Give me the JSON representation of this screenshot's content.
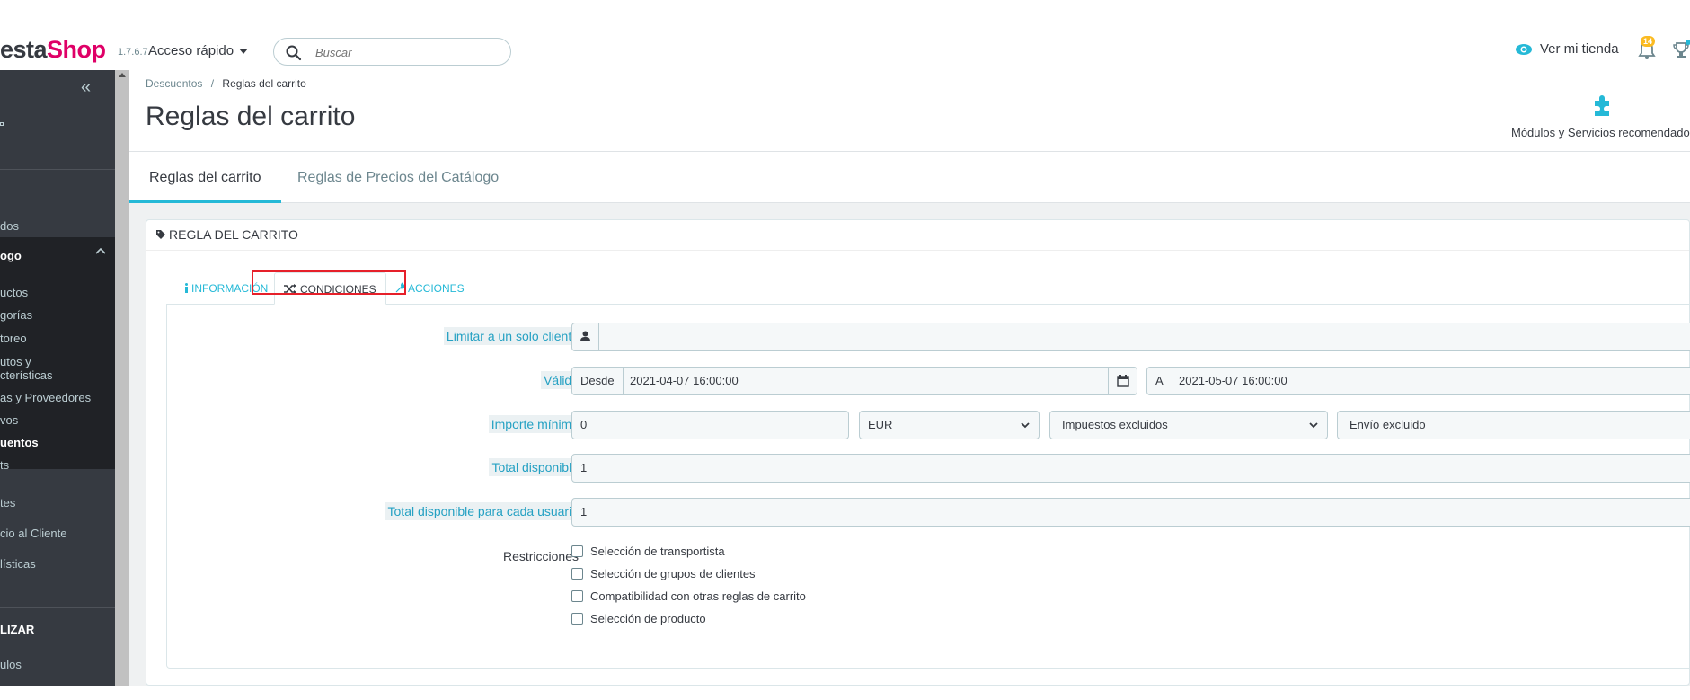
{
  "header": {
    "logo_part1": "",
    "logo_part2": "esta",
    "logo_part3": "Shop",
    "version": "1.7.6.7",
    "quick_access": "Acceso rápido",
    "search_placeholder": "Buscar",
    "view_shop": "Ver mi tienda",
    "notifications_count": "14"
  },
  "sidebar": {
    "items": [
      {
        "label": "dos"
      },
      {
        "label": "ogo"
      },
      {
        "label": "uctos"
      },
      {
        "label": "gorías"
      },
      {
        "label": "toreo"
      },
      {
        "label": "utos y"
      },
      {
        "label": "cterísticas"
      },
      {
        "label": "as y Proveedores"
      },
      {
        "label": "vos"
      },
      {
        "label": "uentos"
      },
      {
        "label": "ts"
      },
      {
        "label": "tes"
      },
      {
        "label": "cio al Cliente"
      },
      {
        "label": "lísticas"
      },
      {
        "label": "LIZAR"
      },
      {
        "label": "ulos"
      }
    ]
  },
  "breadcrumb": {
    "parent": "Descuentos",
    "separator": "/",
    "current": "Reglas del carrito"
  },
  "page": {
    "title": "Reglas del carrito",
    "modules_label": "Módulos y Servicios recomendados"
  },
  "tabs": [
    {
      "label": "Reglas del carrito"
    },
    {
      "label": "Reglas de Precios del Catálogo"
    }
  ],
  "panel": {
    "heading": "REGLA DEL CARRITO",
    "subtabs": [
      {
        "label": "INFORMACIÓN"
      },
      {
        "label": "CONDICIONES"
      },
      {
        "label": "ACCIONES"
      }
    ]
  },
  "form": {
    "customer_label": "Limitar a un solo cliente",
    "valid_label": "Válido",
    "from_label": "Desde",
    "from_value": "2021-04-07 16:00:00",
    "to_label": "A",
    "to_value": "2021-05-07 16:00:00",
    "min_amount_label": "Importe mínimo",
    "min_amount_value": "0",
    "currency_value": "EUR",
    "tax_value": "Impuestos excluidos",
    "shipping_value": "Envío excluido",
    "total_available_label": "Total disponible",
    "total_available_value": "1",
    "total_per_user_label": "Total disponible para cada usuario",
    "total_per_user_value": "1",
    "restrictions_label": "Restricciones",
    "restrictions": [
      {
        "label": "Selección de transportista"
      },
      {
        "label": "Selección de grupos de clientes"
      },
      {
        "label": "Compatibilidad con otras reglas de carrito"
      },
      {
        "label": "Selección de producto"
      }
    ]
  },
  "colors": {
    "primary": "#25b9d7",
    "sidebar_bg": "#363a41",
    "brand_pink": "#df0067",
    "highlight_red": "#e6202a"
  }
}
